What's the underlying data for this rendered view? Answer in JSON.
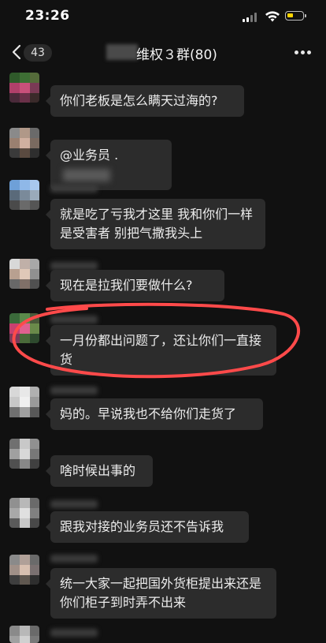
{
  "status_bar": {
    "time": "23:26"
  },
  "nav": {
    "unread_count": "43",
    "title": "维权３群(80)"
  },
  "messages": [
    {
      "text": "你们老板是怎么瞒天过海的?"
    },
    {
      "text": "@业务员 ."
    },
    {
      "text": "就是吃了亏我才这里 我和你们一样是受害者 别把气撒我头上"
    },
    {
      "text": "现在是拉我们要做什么?"
    },
    {
      "text": "一月份都出问题了，还让你们一直接货"
    },
    {
      "text": "妈的。早说我也不给你们走货了"
    },
    {
      "text": "啥时候出事的"
    },
    {
      "text": "跟我对接的业务员还不告诉我"
    },
    {
      "text": "统一大家一起把国外货柜提出来还是你们柜子到时弄不出来"
    }
  ],
  "colors": {
    "background": "#111111",
    "bubble": "#2c2c2c",
    "annotation": "#ff4a4a",
    "battery": "#ffd400"
  },
  "icons": [
    "back-arrow-icon",
    "more-icon",
    "signal-icon",
    "wifi-icon",
    "battery-icon"
  ]
}
